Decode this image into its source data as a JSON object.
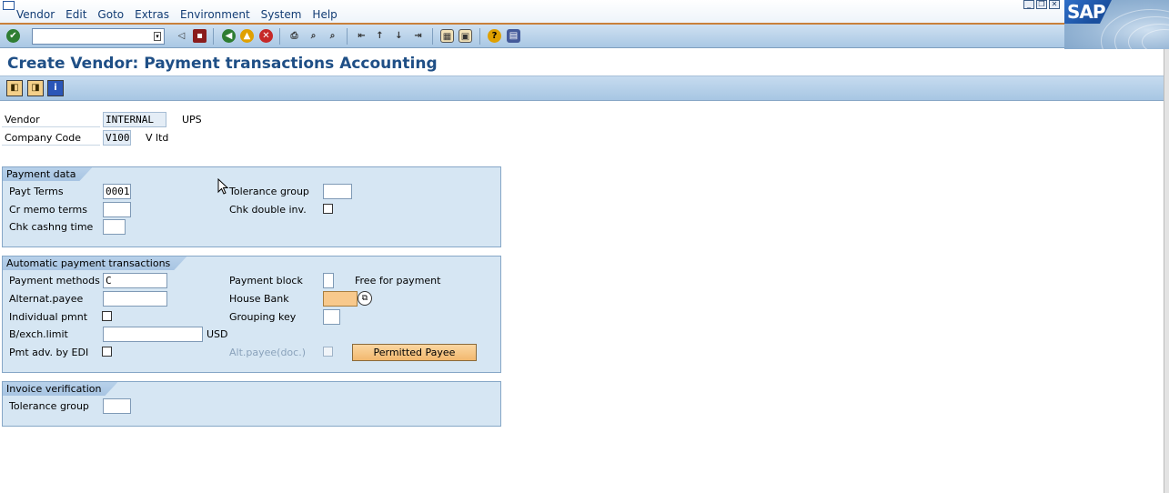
{
  "menu": {
    "items": [
      "Vendor",
      "Edit",
      "Goto",
      "Extras",
      "Environment",
      "System",
      "Help"
    ]
  },
  "logo": "SAP",
  "command_field": {
    "value": ""
  },
  "title": "Create Vendor: Payment transactions Accounting",
  "header": {
    "vendor_label": "Vendor",
    "vendor_value": "INTERNAL",
    "vendor_name": "UPS",
    "company_code_label": "Company Code",
    "company_code_value": "V100",
    "company_name": "V ltd"
  },
  "payment_data": {
    "title": "Payment data",
    "payt_terms_label": "Payt Terms",
    "payt_terms_value": "0001",
    "cr_memo_terms_label": "Cr memo terms",
    "cr_memo_terms_value": "",
    "chk_cashing_label": "Chk cashng time",
    "chk_cashing_value": "",
    "tolerance_group_label": "Tolerance group",
    "tolerance_group_value": "",
    "chk_double_inv_label": "Chk double inv."
  },
  "auto_payment": {
    "title": "Automatic payment transactions",
    "payment_methods_label": "Payment methods",
    "payment_methods_value": "C",
    "alternat_payee_label": "Alternat.payee",
    "alternat_payee_value": "",
    "individual_pmnt_label": "Individual pmnt",
    "bexch_limit_label": "B/exch.limit",
    "bexch_limit_value": "",
    "currency": "USD",
    "pmt_adv_edi_label": "Pmt adv. by EDI",
    "payment_block_label": "Payment block",
    "payment_block_value": "",
    "payment_block_text": "Free for payment",
    "house_bank_label": "House Bank",
    "house_bank_value": "",
    "grouping_key_label": "Grouping key",
    "grouping_key_value": "",
    "alt_payee_doc_label": "Alt.payee(doc.)",
    "permitted_payee_button": "Permitted Payee"
  },
  "invoice_verification": {
    "title": "Invoice verification",
    "tolerance_group_label": "Tolerance group",
    "tolerance_group_value": ""
  },
  "colors": {
    "title_text": "#1f4f86",
    "group_bg": "#d6e6f3",
    "focus_field": "#f8c98c",
    "menu_border": "#c9803a"
  }
}
